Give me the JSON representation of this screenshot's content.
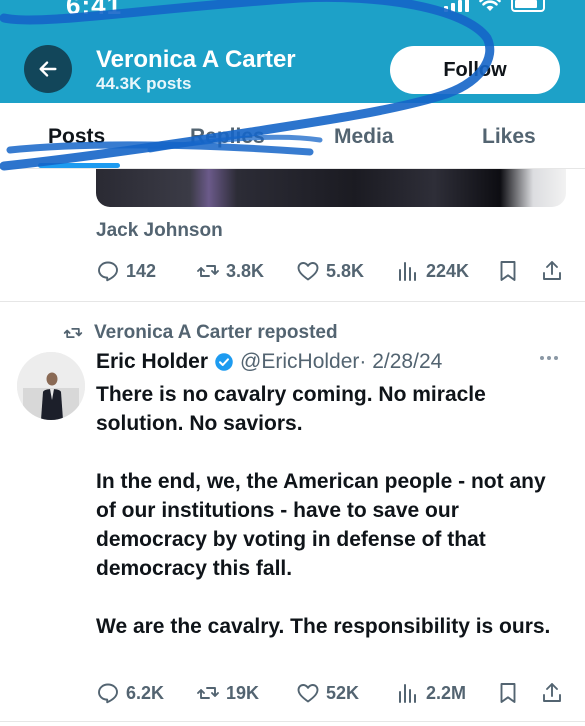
{
  "status_bar": {
    "time": "6:41"
  },
  "header": {
    "name": "Veronica A Carter",
    "post_count": "44.3K posts",
    "follow_label": "Follow",
    "accent_color": "#1da1c8"
  },
  "tabs": [
    {
      "label": "Posts",
      "active": true
    },
    {
      "label": "Replies",
      "active": false
    },
    {
      "label": "Media",
      "active": false
    },
    {
      "label": "Likes",
      "active": false
    }
  ],
  "post1": {
    "quoted_name": "Jack Johnson",
    "stats": {
      "replies": "142",
      "reposts": "3.8K",
      "likes": "5.8K",
      "views": "224K"
    }
  },
  "post2": {
    "repost_label": "Veronica A Carter reposted",
    "author_name": "Eric Holder",
    "author_handle": "@EricHolder",
    "date": "· 2/28/24",
    "paragraphs": [
      "There is no cavalry coming.  No miracle solution. No saviors.",
      "In the end, we, the American people - not any of our institutions - have to save our democracy by voting in defense of that democracy this fall.",
      "We are the cavalry. The responsibility is ours."
    ],
    "stats": {
      "replies": "6.2K",
      "reposts": "19K",
      "likes": "52K",
      "views": "2.2M"
    }
  },
  "icons": {
    "back": "arrow-left-icon",
    "reply": "reply-icon",
    "repost": "repost-icon",
    "like": "heart-icon",
    "views": "views-icon",
    "bookmark": "bookmark-icon",
    "share": "share-icon",
    "verified": "verified-badge-icon",
    "more": "more-icon"
  }
}
